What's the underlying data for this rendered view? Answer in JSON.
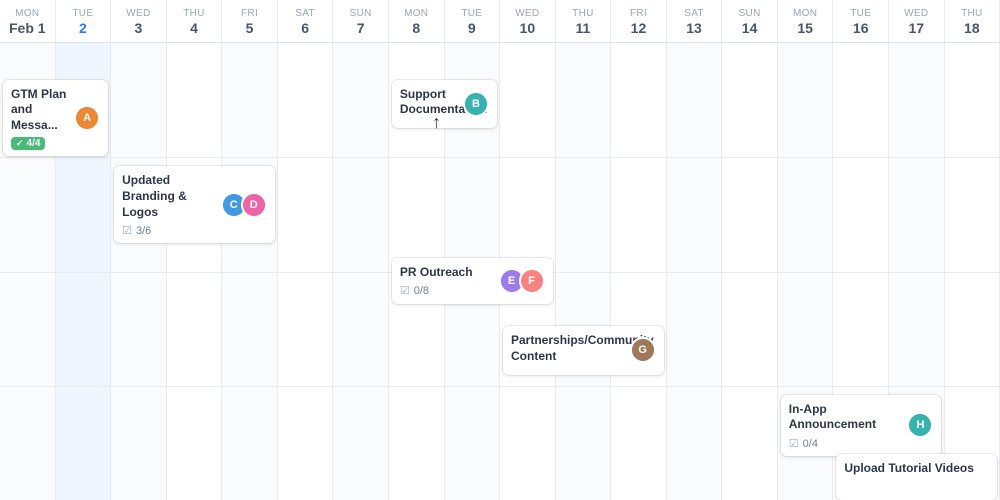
{
  "calendar": {
    "headers": [
      {
        "id": "mon-feb1",
        "day_name": "MON",
        "day_num": "Feb 1",
        "today": false
      },
      {
        "id": "tue-2",
        "day_name": "TUE",
        "day_num": "2",
        "today": true
      },
      {
        "id": "wed-3",
        "day_name": "WED",
        "day_num": "3",
        "today": false
      },
      {
        "id": "thu-4",
        "day_name": "THU",
        "day_num": "4",
        "today": false
      },
      {
        "id": "fri-5",
        "day_name": "FRI",
        "day_num": "5",
        "today": false
      },
      {
        "id": "sat-6",
        "day_name": "SAT",
        "day_num": "6",
        "today": false
      },
      {
        "id": "sun-7",
        "day_name": "SUN",
        "day_num": "7",
        "today": false
      },
      {
        "id": "mon-8",
        "day_name": "MON",
        "day_num": "8",
        "today": false
      },
      {
        "id": "tue-9",
        "day_name": "TUE",
        "day_num": "9",
        "today": false
      },
      {
        "id": "wed-10",
        "day_name": "WED",
        "day_num": "10",
        "today": false
      },
      {
        "id": "thu-11",
        "day_name": "THU",
        "day_num": "11",
        "today": false
      },
      {
        "id": "fri-12",
        "day_name": "FRI",
        "day_num": "12",
        "today": false
      },
      {
        "id": "sat-13",
        "day_name": "SAT",
        "day_num": "13",
        "today": false
      },
      {
        "id": "sun-14",
        "day_name": "SUN",
        "day_num": "14",
        "today": false
      },
      {
        "id": "mon-15",
        "day_name": "MON",
        "day_num": "15",
        "today": false
      },
      {
        "id": "tue-16",
        "day_name": "TUE",
        "day_num": "16",
        "today": false
      },
      {
        "id": "wed-17",
        "day_name": "WED",
        "day_num": "17",
        "today": false
      },
      {
        "id": "thu-18",
        "day_name": "THU",
        "day_num": "18",
        "today": false
      }
    ],
    "cards": [
      {
        "id": "gtm-plan",
        "title": "GTM Plan and Messa...",
        "badge": "4/4",
        "badge_type": "green",
        "avatars": [
          {
            "initials": "A",
            "color": "av-orange"
          }
        ],
        "col_start": 0,
        "col_span": 2,
        "row": 0,
        "top_pct": 8,
        "has_badge_icon": true
      },
      {
        "id": "support-doc",
        "title": "Support Documentation",
        "avatars": [
          {
            "initials": "B",
            "color": "av-teal"
          }
        ],
        "col_start": 7,
        "col_span": 2,
        "row": 0,
        "top_pct": 8
      },
      {
        "id": "updated-branding",
        "title": "Updated Branding & Logos",
        "badge": "3/6",
        "badge_type": "grey",
        "avatars": [
          {
            "initials": "C",
            "color": "av-blue"
          },
          {
            "initials": "D",
            "color": "av-pink"
          }
        ],
        "col_start": 2,
        "col_span": 3,
        "row": 1,
        "top_pct": 27
      },
      {
        "id": "pr-outreach",
        "title": "PR Outreach",
        "badge": "0/8",
        "badge_type": "grey",
        "avatars": [
          {
            "initials": "E",
            "color": "av-purple"
          },
          {
            "initials": "F",
            "color": "av-red"
          }
        ],
        "col_start": 7,
        "col_span": 3,
        "row": 2,
        "top_pct": 47
      },
      {
        "id": "partnerships",
        "title": "Partnerships/Community Content",
        "avatars": [
          {
            "initials": "G",
            "color": "av-brown"
          }
        ],
        "col_start": 9,
        "col_span": 3,
        "row": 3,
        "top_pct": 62
      },
      {
        "id": "in-app-announce",
        "title": "In-App Announcement",
        "badge": "0/4",
        "badge_type": "grey",
        "avatars": [
          {
            "initials": "H",
            "color": "av-teal"
          }
        ],
        "col_start": 14,
        "col_span": 3,
        "row": 4,
        "top_pct": 77
      },
      {
        "id": "upload-tutorial",
        "title": "Upload Tutorial Videos",
        "avatars": [],
        "col_start": 15,
        "col_span": 3,
        "row": 5,
        "top_pct": 90
      }
    ]
  },
  "colors": {
    "today_blue": "#2b7de9",
    "green_badge": "#48bb78",
    "grey_check": "#a0aec0"
  }
}
